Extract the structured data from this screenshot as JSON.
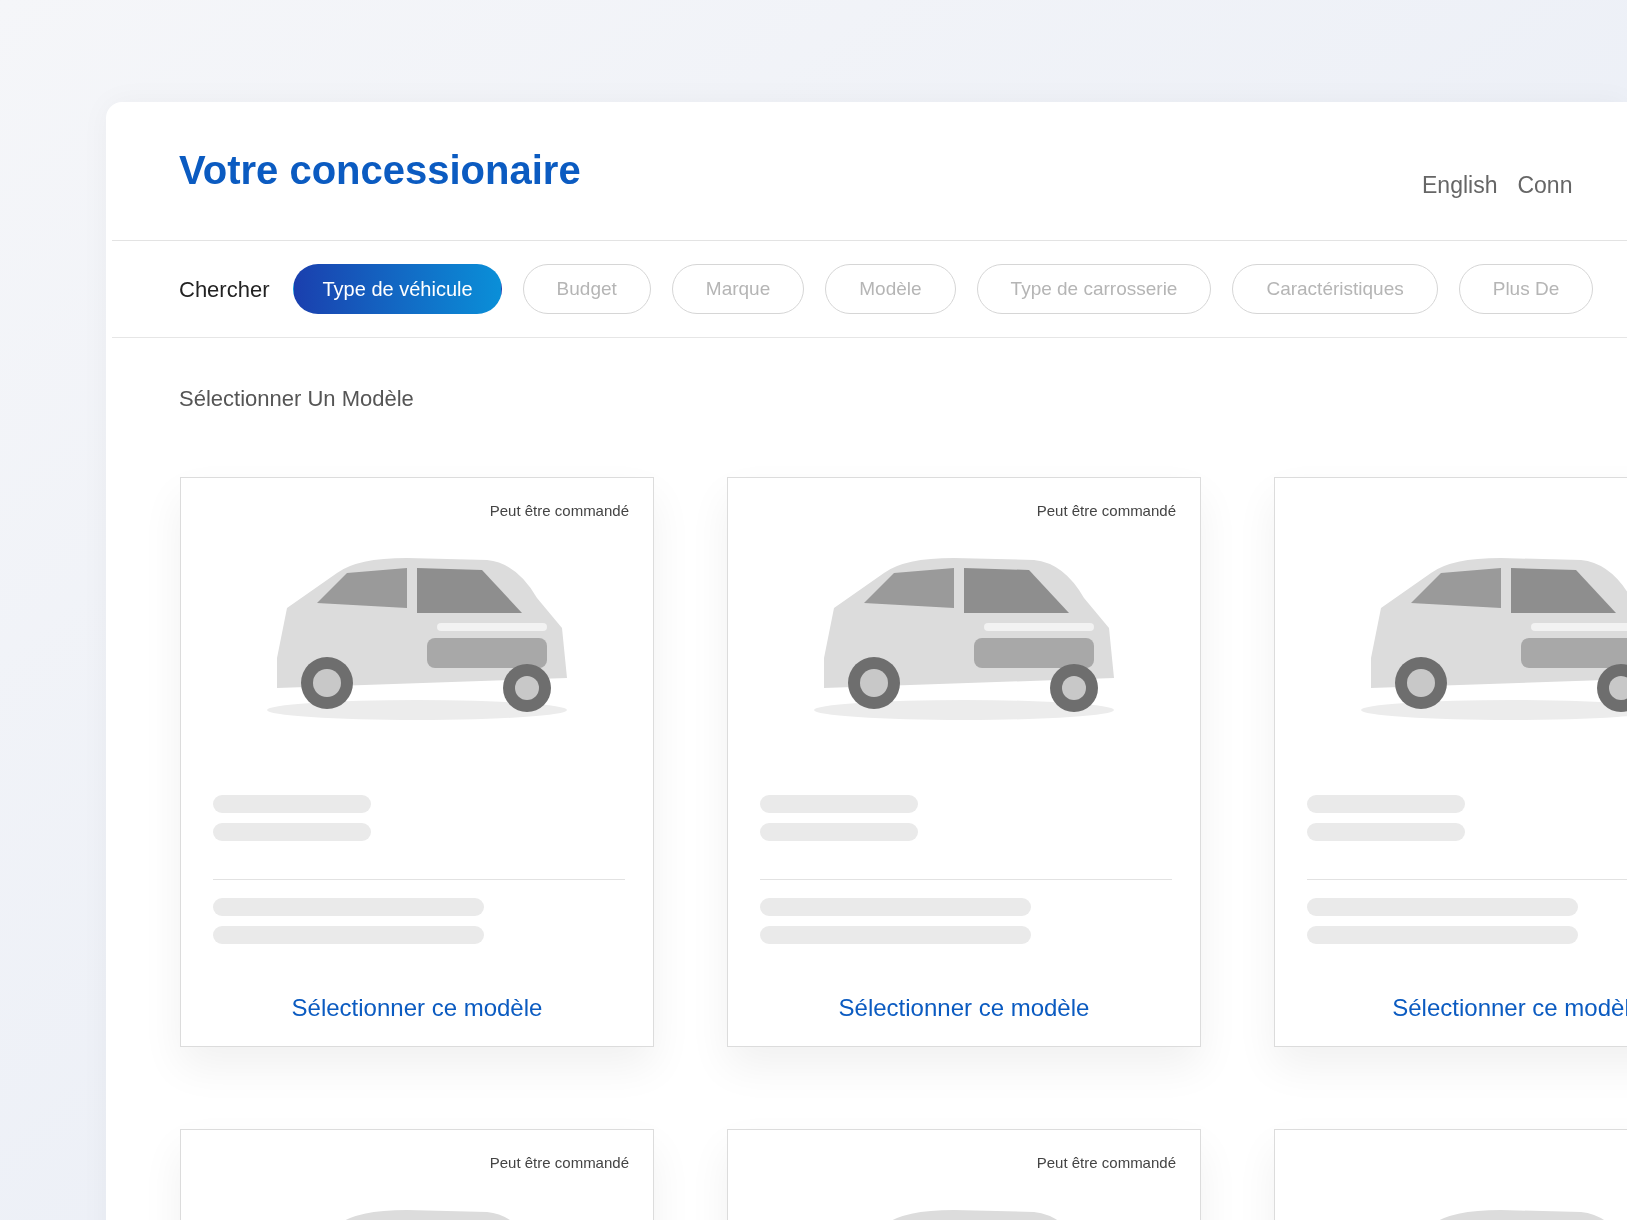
{
  "header": {
    "title": "Votre concessionaire",
    "links": [
      "English",
      "Conn"
    ]
  },
  "filters": {
    "label": "Chercher",
    "chips": [
      {
        "label": "Type de véhicule",
        "selected": true
      },
      {
        "label": "Budget",
        "selected": false
      },
      {
        "label": "Marque",
        "selected": false
      },
      {
        "label": "Modèle",
        "selected": false
      },
      {
        "label": "Type de carrosserie",
        "selected": false
      },
      {
        "label": "Caractéristiques",
        "selected": false
      },
      {
        "label": "Plus De",
        "selected": false
      }
    ]
  },
  "section_title": "Sélectionner Un Modèle",
  "cards": [
    {
      "badge": "Peut être commandé",
      "action": "Sélectionner ce modèle",
      "image": {
        "kind": "picture"
      }
    },
    {
      "badge": "Peut être commandé",
      "action": "Sélectionner ce modèle",
      "image": {
        "kind": "picture"
      }
    },
    {
      "action": "Sélectionner ce modèl",
      "image": {
        "kind": "picture"
      }
    },
    {
      "badge": "Peut être commandé",
      "image": {
        "kind": "picture"
      }
    },
    {
      "badge": "Peut être commandé",
      "image": {
        "kind": "picture"
      }
    },
    {
      "image": {
        "kind": "picture"
      }
    }
  ]
}
